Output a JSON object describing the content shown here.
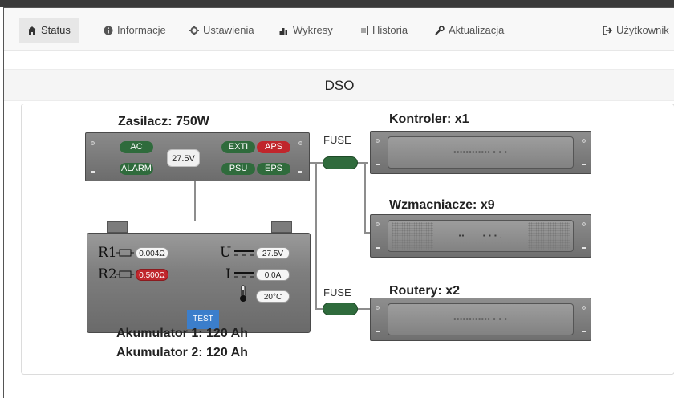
{
  "nav": {
    "items": [
      {
        "label": "Status",
        "icon": "home-icon",
        "active": true
      },
      {
        "label": "Informacje",
        "icon": "info-icon"
      },
      {
        "label": "Ustawienia",
        "icon": "gear-icon"
      },
      {
        "label": "Wykresy",
        "icon": "bar-chart-icon"
      },
      {
        "label": "Historia",
        "icon": "list-icon"
      },
      {
        "label": "Aktualizacja",
        "icon": "wrench-icon"
      }
    ],
    "user": {
      "label": "Użytkownik",
      "icon": "logout-icon"
    }
  },
  "page": {
    "title": "DSO"
  },
  "psu": {
    "title": "Zasilacz: 750W",
    "voltage": "27.5V",
    "indicators": {
      "ac": "AC",
      "alarm": "ALARM",
      "exti": "EXTI",
      "aps": "APS",
      "psu": "PSU",
      "eps": "EPS"
    }
  },
  "fuses": {
    "top": "FUSE",
    "bottom": "FUSE"
  },
  "devices": {
    "controller": "Kontroler: x1",
    "amplifiers": "Wzmacniacze: x9",
    "routers": "Routery: x2"
  },
  "battery": {
    "r1_label": "R1",
    "r1_value": "0.004Ω",
    "r2_label": "R2",
    "r2_value": "0.500Ω",
    "u_label": "U",
    "u_value": "27.5V",
    "i_label": "I",
    "i_value": "0.0A",
    "temp_value": "20°C",
    "test_label": "TEST",
    "acc1": "Akumulator 1: 120 Ah",
    "acc2": "Akumulator 2: 120 Ah"
  },
  "colors": {
    "ok": "#2f6b3c",
    "alert": "#c0262c",
    "test": "#3b7ecb"
  }
}
